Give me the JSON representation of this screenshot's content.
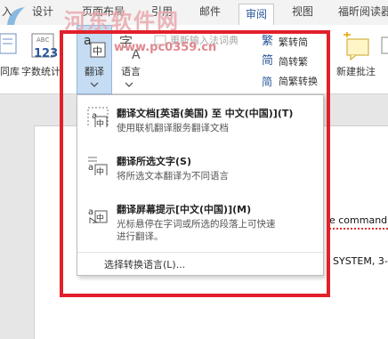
{
  "tabs": [
    {
      "id": "insert",
      "label": "入"
    },
    {
      "id": "design",
      "label": "设计"
    },
    {
      "id": "layout",
      "label": "页面布局"
    },
    {
      "id": "references",
      "label": "引用"
    },
    {
      "id": "mailings",
      "label": "邮件"
    },
    {
      "id": "review",
      "label": "审阅",
      "active": true
    },
    {
      "id": "view",
      "label": "视图"
    },
    {
      "id": "foxit",
      "label": "福昕阅读器"
    }
  ],
  "ribbon": {
    "thesaurus_label": "同库",
    "wordcount_label": "字数统计",
    "wordcount_num": "123",
    "translate_label": "翻译",
    "language_label": "语言",
    "update_ime_label": "更新输入法词典",
    "to_traditional": "繁转简",
    "to_simplified": "简转繁",
    "convert": "简繁转换",
    "new_comment": "新建批注",
    "trad_glyph": "繁",
    "simp_glyph": "简"
  },
  "watermark": {
    "line1": "河东软件网",
    "line2": "www.pc0359.cn"
  },
  "document": {
    "text1": "e command",
    "text2": "SYSTEM, 3-"
  },
  "menu": {
    "items": [
      {
        "title": "翻译文档[英语(美国) 至 中文(中国)](T)",
        "desc": "使用联机翻译服务翻译文档"
      },
      {
        "title": "翻译所选文字(S)",
        "desc": "将所选文本翻译为不同语言"
      },
      {
        "title": "翻译屏幕提示[中文(中国)](M)",
        "desc_line1": "光标悬停在字词或所选的段落上可快速",
        "desc_line2": "进行翻译。"
      }
    ],
    "footer": "选择转换语言(L)..."
  },
  "colors": {
    "accent": "#2b579a",
    "frame": "#e2202a",
    "selected": "#c5dcf3"
  }
}
